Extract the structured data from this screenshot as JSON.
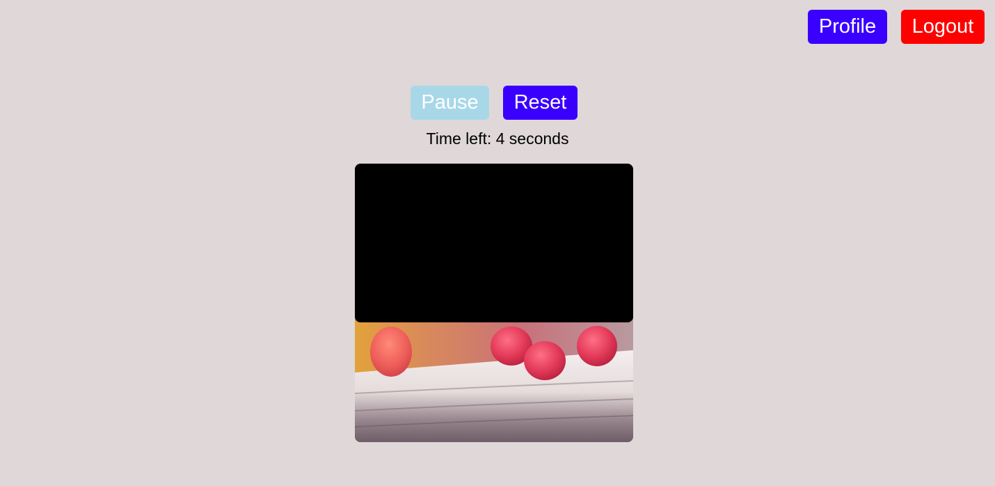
{
  "header": {
    "profile_label": "Profile",
    "logout_label": "Logout",
    "profile_color": "#3a00ff",
    "logout_color": "#ff0000"
  },
  "controls": {
    "pause_label": "Pause",
    "pause_state": "disabled",
    "reset_label": "Reset"
  },
  "timer": {
    "text": "Time left: 4 seconds"
  },
  "image_reveal": {
    "subject": "raspberries on a wooden rail",
    "covered_fraction": 0.57
  }
}
